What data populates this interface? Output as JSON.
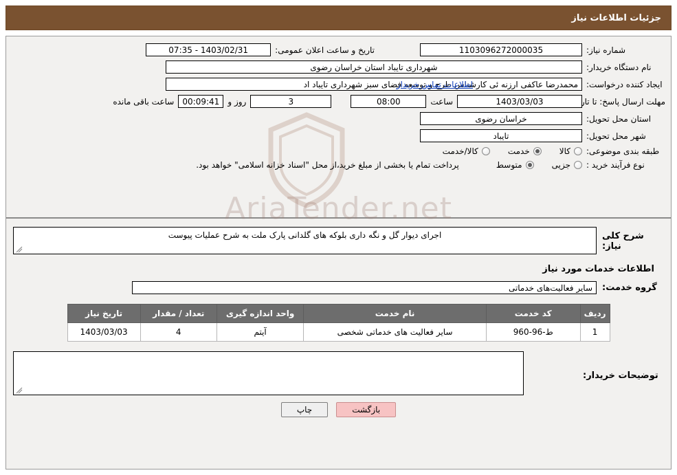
{
  "header": {
    "title": "جزئیات اطلاعات نیاز"
  },
  "form": {
    "need_number_label": "شماره نیاز:",
    "need_number_value": "1103096272000035",
    "announce_datetime_label": "تاریخ و ساعت اعلان عمومی:",
    "announce_datetime_value": "1403/02/31 - 07:35",
    "buyer_org_label": "نام دستگاه خریدار:",
    "buyer_org_value": "شهرداری تایباد استان خراسان رضوی",
    "requester_label": "ایجاد کننده درخواست:",
    "requester_value": "محمدرضا عاکفی ارزنه ئی کارشناس طرح و توسعه فضای سبز شهرداری تایباد اد",
    "requester_link": "اطلاعات تماس خریدار",
    "deadline_label": "مهلت ارسال پاسخ: تا تاریخ:",
    "deadline_date": "1403/03/03",
    "time_label": "ساعت",
    "deadline_time": "08:00",
    "days_value": "3",
    "days_label": "روز و",
    "remaining_time": "00:09:41",
    "remaining_label": "ساعت باقی مانده",
    "province_label": "استان محل تحویل:",
    "province_value": "خراسان رضوی",
    "city_label": "شهر محل تحویل:",
    "city_value": "تایباد",
    "category_label": "طبقه بندی موضوعی:",
    "category_options": [
      {
        "text": "کالا",
        "checked": false
      },
      {
        "text": "خدمت",
        "checked": true
      },
      {
        "text": "کالا/خدمت",
        "checked": false
      }
    ],
    "purchase_type_label": "نوع فرآیند خرید :",
    "purchase_type_options": [
      {
        "text": "جزیی",
        "checked": false
      },
      {
        "text": "متوسط",
        "checked": true
      }
    ],
    "purchase_note": "پرداخت تمام یا بخشی از مبلغ خرید،از محل \"اسناد خزانه اسلامی\" خواهد بود."
  },
  "details": {
    "general_desc_label": "شرح کلی نیاز:",
    "general_desc_value": "اجرای دیوار گل و نگه داری بلوکه های گلدانی پارک ملت به شرح عملیات پیوست",
    "services_title": "اطلاعات خدمات مورد نیاز",
    "service_group_label": "گروه خدمت:",
    "service_group_value": "سایر فعالیت‌های خدماتی",
    "table": {
      "headers": [
        "ردیف",
        "کد خدمت",
        "نام خدمت",
        "واحد اندازه گیری",
        "تعداد / مقدار",
        "تاریخ نیاز"
      ],
      "rows": [
        {
          "row": "1",
          "code": "ط-96-960",
          "name": "سایر فعالیت های خدماتی شخصی",
          "unit": "آیتم",
          "qty": "4",
          "date": "1403/03/03"
        }
      ]
    },
    "buyer_notes_label": "توضیحات خریدار:",
    "buyer_notes_value": ""
  },
  "footer": {
    "print_label": "چاپ",
    "back_label": "بازگشت"
  },
  "watermark": {
    "text": "AriaTender.net"
  },
  "colors": {
    "header_bg": "#7a5230",
    "panel_bg": "#f2f1ef",
    "link": "#1342bd",
    "table_header_bg": "#6d6d6d",
    "back_button_bg": "#f7c3c3"
  }
}
